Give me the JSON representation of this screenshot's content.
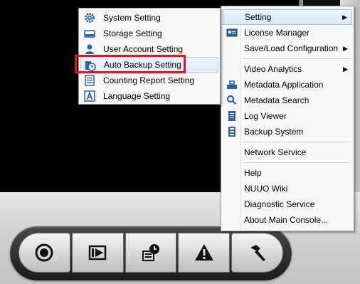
{
  "main_menu": {
    "items": [
      {
        "label": "Setting",
        "has_submenu": true,
        "highlighted": true
      },
      {
        "label": "License Manager",
        "icon": "license-card-icon"
      },
      {
        "label": "Save/Load Configuration",
        "has_submenu": true
      },
      {
        "label": "Video Analytics",
        "has_submenu": true
      },
      {
        "label": "Metadata Application",
        "icon": "metadata-app-icon"
      },
      {
        "label": "Metadata Search",
        "icon": "metadata-search-icon"
      },
      {
        "label": "Log Viewer",
        "icon": "log-viewer-icon"
      },
      {
        "label": "Backup System",
        "icon": "backup-system-icon"
      },
      {
        "label": "Network Service"
      },
      {
        "label": "Help"
      },
      {
        "label": "NUUO Wiki"
      },
      {
        "label": "Diagnostic Service"
      },
      {
        "label": "About Main Console..."
      }
    ]
  },
  "submenu": {
    "items": [
      {
        "label": "System Setting",
        "icon": "gear-icon"
      },
      {
        "label": "Storage Setting",
        "icon": "storage-drive-icon"
      },
      {
        "label": "User Account Setting",
        "icon": "user-icon"
      },
      {
        "label": "Auto Backup Setting",
        "icon": "auto-backup-clock-icon",
        "highlighted": true
      },
      {
        "label": "Counting Report Setting",
        "icon": "report-sheet-icon"
      },
      {
        "label": "Language Setting",
        "icon": "language-a-icon"
      }
    ]
  },
  "toolbar": {
    "buttons": [
      "record-icon",
      "playback-icon",
      "schedule-icon",
      "warning-icon",
      "tools-hammer-icon"
    ]
  },
  "colors": {
    "highlight_border": "#e3151a",
    "menu_hover_bg": "#d9e8fa",
    "icon_blue": "#2a64b0"
  }
}
